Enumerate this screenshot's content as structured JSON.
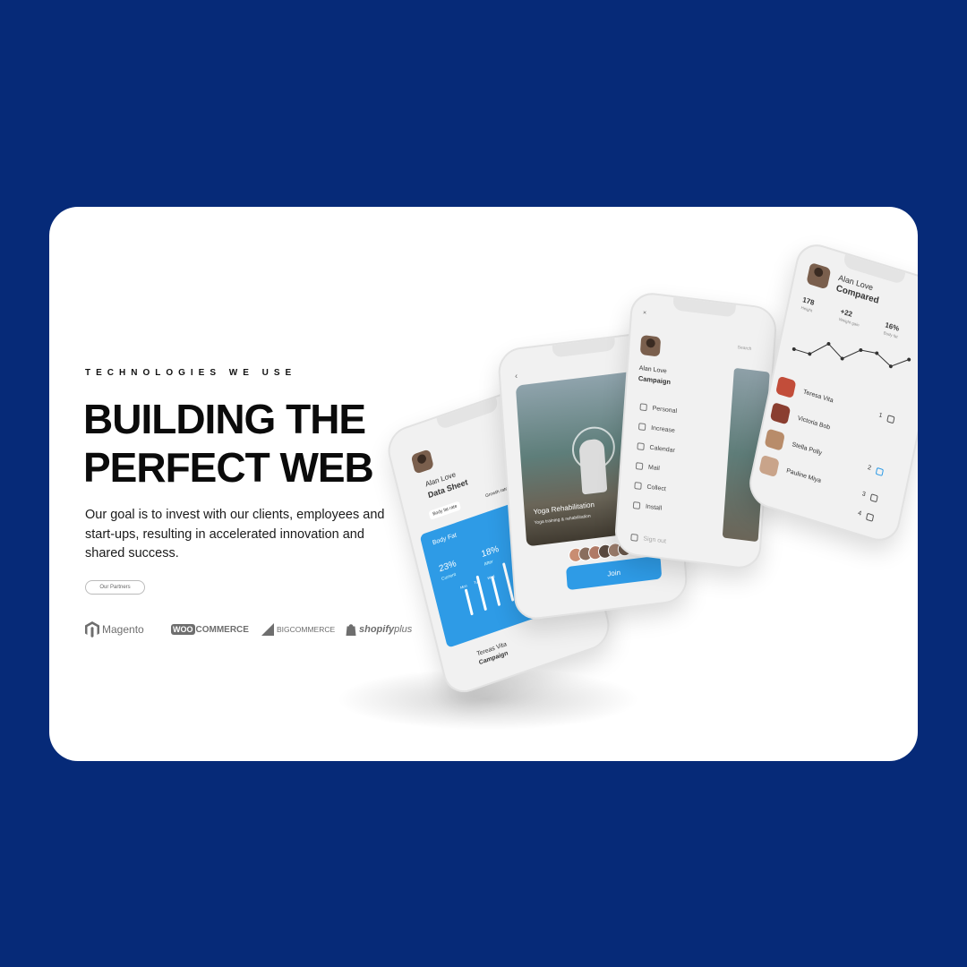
{
  "hero": {
    "eyebrow": "TECHNOLOGIES WE USE",
    "headline": "BUILDING THE PERFECT WEB",
    "body": "Our goal is to invest with our clients, employees and start-ups, resulting in accelerated innovation and shared success.",
    "partners_button": "Our Partners"
  },
  "partners": {
    "magento": "Magento",
    "woo_prefix": "WOO",
    "woo_suffix": "COMMERCE",
    "bigcommerce": "BIGCOMMERCE",
    "shopify": "shopify",
    "shopify_plus": "plus"
  },
  "colors": {
    "background": "#062a78",
    "card": "#ffffff",
    "accent_blue": "#2e9be6"
  },
  "phones": {
    "data_sheet": {
      "name": "Alan Love",
      "title": "Data Sheet",
      "tab1": "Body fat rate",
      "tab2": "Growth rate",
      "panel_title": "Body Fat",
      "stat1_value": "23%",
      "stat1_label": "Current",
      "stat2_value": "18%",
      "stat2_label": "After",
      "days": [
        "Mon",
        "Tue",
        "Wed"
      ],
      "footer_name": "Tereas Vita",
      "footer_title": "Campaign"
    },
    "yoga": {
      "title": "Yoga Rehabilitation",
      "subtitle": "Yoga training & rehabilitation",
      "join": "Join"
    },
    "campaign": {
      "name": "Alan Love",
      "title": "Campaign",
      "search": "Search",
      "menu": [
        "Personal",
        "Increase",
        "Calendar",
        "Mail",
        "Collect",
        "Install"
      ],
      "signout": "Sign out"
    },
    "compared": {
      "name": "Alan Love",
      "title": "Compared",
      "stat1_value": "178",
      "stat1_label": "Height",
      "stat2_value": "+22",
      "stat2_label": "Weight gain",
      "stat3_value": "16%",
      "stat3_label": "Body fat",
      "line_values": [
        0.3,
        0.3,
        0.75,
        0.45,
        0.85,
        0.9,
        0.65,
        1.0
      ],
      "people": [
        {
          "name": "Teresa Vita",
          "rank": "1"
        },
        {
          "name": "Victoria Bob",
          "rank": ""
        },
        {
          "name": "Stella Polly",
          "rank": "2"
        },
        {
          "name": "Pauline Miya",
          "rank": "3"
        }
      ],
      "extra_rank": "4"
    }
  }
}
